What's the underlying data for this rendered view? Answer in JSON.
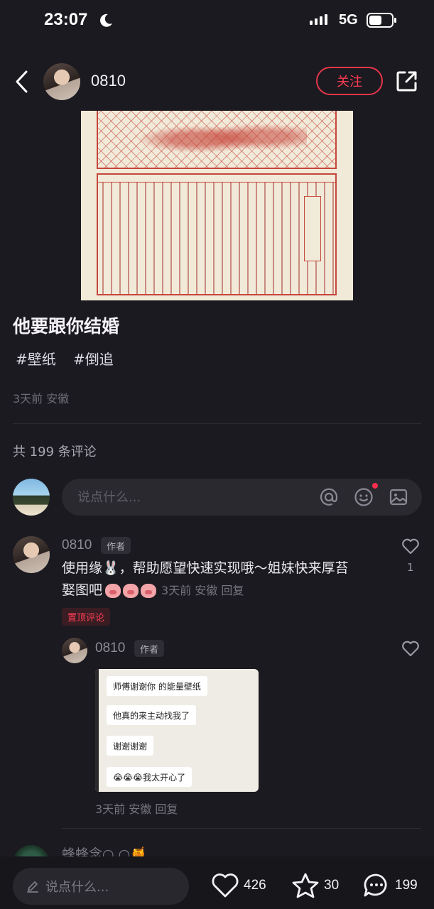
{
  "status_bar": {
    "time": "23:07",
    "network": "5G",
    "battery_level": 0.55
  },
  "header": {
    "author_name": "0810",
    "follow_label": "关注"
  },
  "post": {
    "title": "他要跟你结婚",
    "tags": [
      "#壁纸",
      "#倒追"
    ],
    "meta": "3天前 安徽"
  },
  "comments_section": {
    "count_label": "共 199 条评论",
    "input_placeholder": "说点什么...",
    "comments": [
      {
        "name": "0810",
        "badge": "作者",
        "text_line1": "使用缘🐰，帮助愿望快速实现哦～姐妹快来厚苔",
        "text_line2": "娶图吧",
        "meta": "3天前 安徽 回复",
        "pinned_label": "置顶评论",
        "likes": "1",
        "reply": {
          "name": "0810",
          "badge": "作者",
          "meta": "3天前 安徽 回复",
          "screenshot_messages": [
            "师傅谢谢你 的能量壁纸",
            "他真的来主动找我了",
            "谢谢谢谢",
            "😭😭😭我太开心了"
          ]
        }
      }
    ],
    "next_comment_name": "蜂蜂念○.○🍯"
  },
  "bottom_bar": {
    "input_placeholder": "说点什么...",
    "likes": "426",
    "favorites": "30",
    "comments": "199"
  }
}
